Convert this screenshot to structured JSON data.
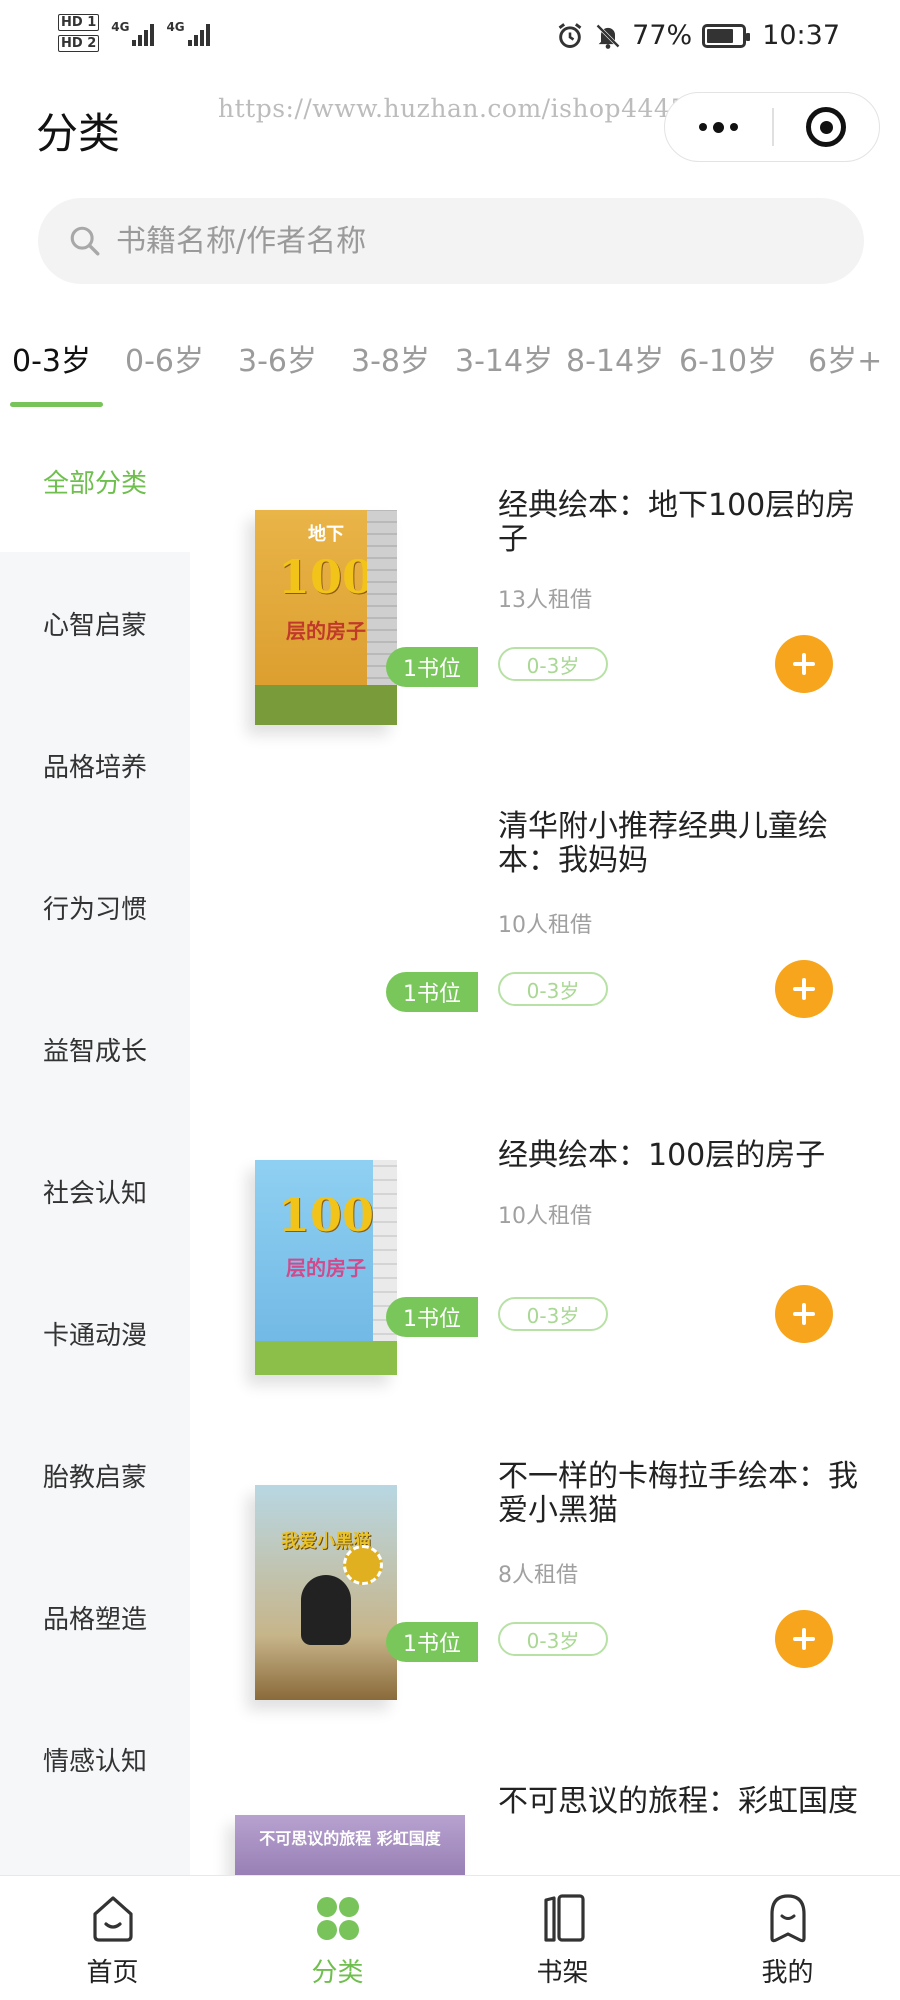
{
  "status_bar": {
    "sim1": "HD 1",
    "sim2": "HD 2",
    "network1": "4G",
    "network2": "4G",
    "battery": "77%",
    "battery_level": 0.77,
    "time": "10:37"
  },
  "header": {
    "title": "分类",
    "watermark": "https://www.huzhan.com/ishop44453"
  },
  "search": {
    "placeholder": "书籍名称/作者名称",
    "value": ""
  },
  "age_tabs": [
    "0-3岁",
    "0-6岁",
    "3-6岁",
    "3-8岁",
    "3-14岁",
    "8-14岁",
    "6-10岁",
    "6岁+"
  ],
  "active_age_tab": "0-3岁",
  "sidebar": {
    "items": [
      "全部分类",
      "心智启蒙",
      "品格培养",
      "行为习惯",
      "益智成长",
      "社会认知",
      "卡通动漫",
      "胎教启蒙",
      "品格塑造",
      "情感认知"
    ],
    "active": "全部分类"
  },
  "books": [
    {
      "title": "经典绘本：地下100层的房子",
      "rent": "13人租借",
      "age": "0-3岁",
      "slot": "1书位",
      "cover_title": "100",
      "cover_sub": "层的房子",
      "cover_top": "地下",
      "cover_color": "#e3a433"
    },
    {
      "title": "清华附小推荐经典儿童绘本：我妈妈",
      "rent": "10人租借",
      "age": "0-3岁",
      "slot": "1书位"
    },
    {
      "title": "经典绘本：100层的房子",
      "rent": "10人租借",
      "age": "0-3岁",
      "slot": "1书位",
      "cover_title": "100",
      "cover_sub": "层的房子",
      "cover_color": "#7ec3ea"
    },
    {
      "title": "不一样的卡梅拉手绘本：我爱小黑猫",
      "rent": "8人租借",
      "age": "0-3岁",
      "slot": "1书位",
      "cover_title": "我爱小黑猫",
      "cover_color": "#a5c9d6"
    },
    {
      "title": "不可思议的旅程：彩虹国度",
      "cover_title": "不可思议的旅程 彩虹国度",
      "cover_color": "#9b7fb5"
    }
  ],
  "bottom_nav": {
    "items": [
      "首页",
      "分类",
      "书架",
      "我的"
    ],
    "active": "分类"
  },
  "colors": {
    "accent_green": "#78c35a",
    "add_orange": "#f7a51d",
    "sidebar_bg": "#f6f7f9"
  }
}
